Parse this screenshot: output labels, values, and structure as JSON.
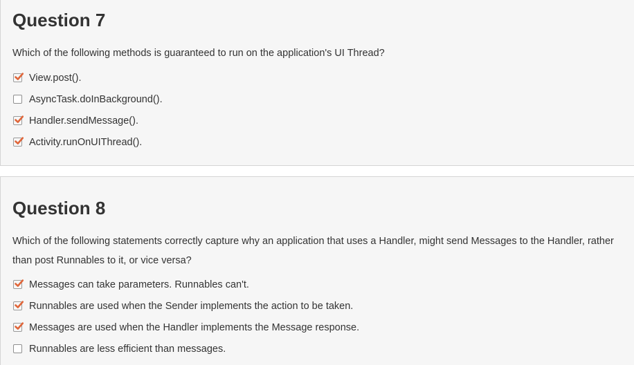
{
  "colors": {
    "card_background": "#f6f6f6",
    "card_border": "#d4d4d4",
    "text": "#333333",
    "checkmark": "#e0663a"
  },
  "questions": [
    {
      "title": "Question 7",
      "text": "Which of the following methods is guaranteed to run on the application's UI Thread?",
      "options": [
        {
          "label": "View.post().",
          "checked": true
        },
        {
          "label": "AsyncTask.doInBackground().",
          "checked": false
        },
        {
          "label": "Handler.sendMessage().",
          "checked": true
        },
        {
          "label": "Activity.runOnUIThread().",
          "checked": true
        }
      ]
    },
    {
      "title": "Question 8",
      "text": "Which of the following statements correctly capture why an application that uses a Handler, might send Messages to the Handler, rather than post Runnables to it, or vice versa?",
      "options": [
        {
          "label": "Messages can take parameters. Runnables can't.",
          "checked": true
        },
        {
          "label": "Runnables are used when the Sender implements the action to be taken.",
          "checked": true
        },
        {
          "label": "Messages are used when the Handler implements the Message response.",
          "checked": true
        },
        {
          "label": "Runnables are less efficient than messages.",
          "checked": false
        }
      ]
    }
  ]
}
